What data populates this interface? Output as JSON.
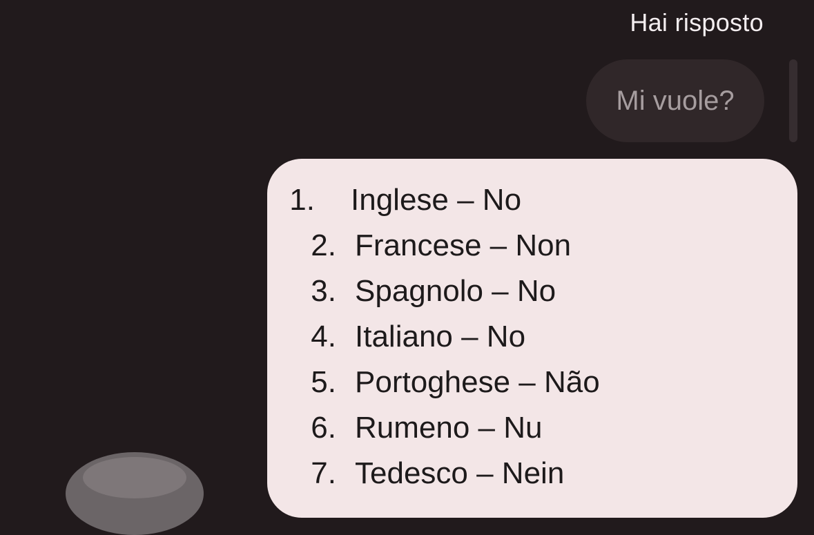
{
  "header": {
    "reply_label": "Hai risposto"
  },
  "quoted_message": {
    "text": "Mi vuole?"
  },
  "message": {
    "items": [
      {
        "number": "1.",
        "text": "Inglese – No"
      },
      {
        "number": "2.",
        "text": "Francese – Non"
      },
      {
        "number": "3.",
        "text": "Spagnolo – No"
      },
      {
        "number": "4.",
        "text": "Italiano – No"
      },
      {
        "number": "5.",
        "text": "Portoghese – Não"
      },
      {
        "number": "6.",
        "text": "Rumeno – Nu"
      },
      {
        "number": "7.",
        "text": "Tedesco – Nein"
      }
    ]
  },
  "colors": {
    "background": "#211a1c",
    "quoted_bubble": "#302729",
    "message_bubble": "#f3e6e7",
    "text_light": "#f4eef0",
    "text_dark": "#1d1a1b"
  }
}
